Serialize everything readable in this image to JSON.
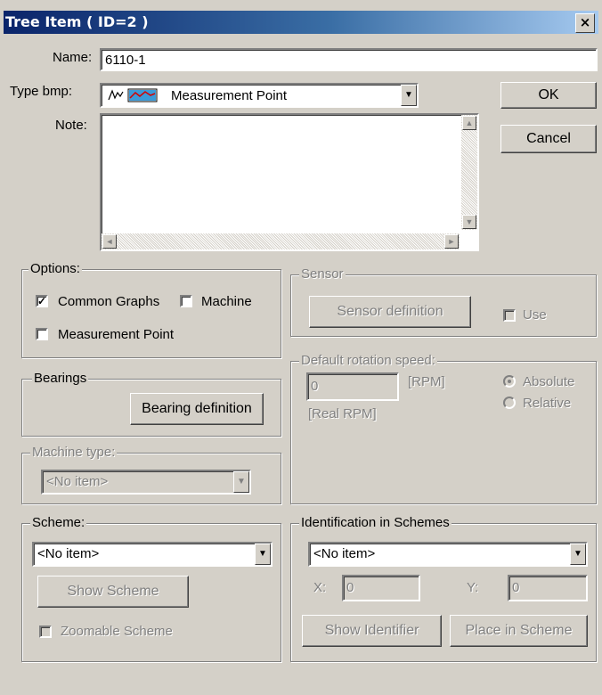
{
  "window": {
    "title": "Tree Item ( ID=2 )",
    "close": "×"
  },
  "name": {
    "label": "Name:",
    "value": "6110-1"
  },
  "type_bmp": {
    "label": "Type bmp:",
    "value": "Measurement Point"
  },
  "note": {
    "label": "Note:",
    "value": ""
  },
  "buttons": {
    "ok": "OK",
    "cancel": "Cancel"
  },
  "options": {
    "title": "Options:",
    "common_graphs": {
      "label": "Common Graphs",
      "checked": true
    },
    "machine": {
      "label": "Machine",
      "checked": false
    },
    "measurement_point": {
      "label": "Measurement Point",
      "checked": false
    }
  },
  "sensor": {
    "title": "Sensor",
    "button": "Sensor definition",
    "use_label": "Use"
  },
  "bearings": {
    "title": "Bearings",
    "button": "Bearing definition"
  },
  "rotation": {
    "title": "Default rotation speed:",
    "value": "0",
    "unit": "[RPM]",
    "sub": "[Real RPM]",
    "absolute": "Absolute",
    "relative": "Relative"
  },
  "machine_type": {
    "title": "Machine type:",
    "value": "<No item>"
  },
  "scheme": {
    "title": "Scheme:",
    "value": "<No item>",
    "show_button": "Show Scheme",
    "zoomable": "Zoomable Scheme"
  },
  "identification": {
    "title": "Identification in Schemes",
    "value": "<No item>",
    "x_label": "X:",
    "x_value": "0",
    "y_label": "Y:",
    "y_value": "0",
    "show_button": "Show Identifier",
    "place_button": "Place in Scheme"
  }
}
